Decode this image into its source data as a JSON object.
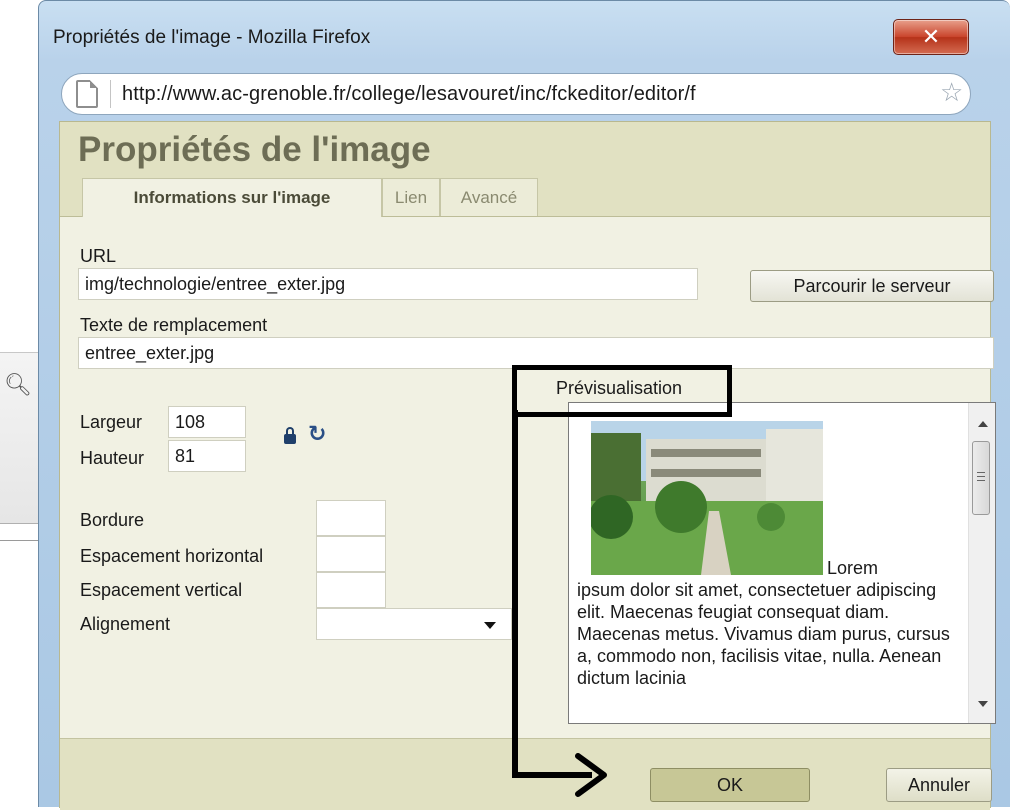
{
  "window": {
    "title": "Propriétés de l'image - Mozilla Firefox",
    "url": "http://www.ac-grenoble.fr/college/lesavouret/inc/fckeditor/editor/f"
  },
  "dialog": {
    "title": "Propriétés de l'image",
    "tabs": [
      {
        "label": "Informations sur l'image",
        "active": true
      },
      {
        "label": "Lien",
        "active": false
      },
      {
        "label": "Avancé",
        "active": false
      }
    ]
  },
  "form": {
    "url_label": "URL",
    "url_value": "img/technologie/entree_exter.jpg",
    "browse_label": "Parcourir le serveur",
    "alt_label": "Texte de remplacement",
    "alt_value": "entree_exter.jpg",
    "width_label": "Largeur",
    "width_value": "108",
    "height_label": "Hauteur",
    "height_value": "81",
    "border_label": "Bordure",
    "border_value": "",
    "hspace_label": "Espacement horizontal",
    "hspace_value": "",
    "vspace_label": "Espacement vertical",
    "vspace_value": "",
    "align_label": "Alignement",
    "align_value": ""
  },
  "preview": {
    "label": "Prévisualisation",
    "first_word": "Lorem",
    "text": "ipsum dolor sit amet, consectetuer adipiscing elit. Maecenas feugiat consequat diam. Maecenas metus. Vivamus diam purus, cursus a, commodo non, facilisis vitae, nulla. Aenean dictum lacinia"
  },
  "footer": {
    "ok_label": "OK",
    "cancel_label": "Annuler"
  },
  "colors": {
    "dialog_bg": "#f1f1e3",
    "header_bg": "#e1e1c2",
    "ok_button": "#c7c796",
    "annotation": "#000000"
  }
}
